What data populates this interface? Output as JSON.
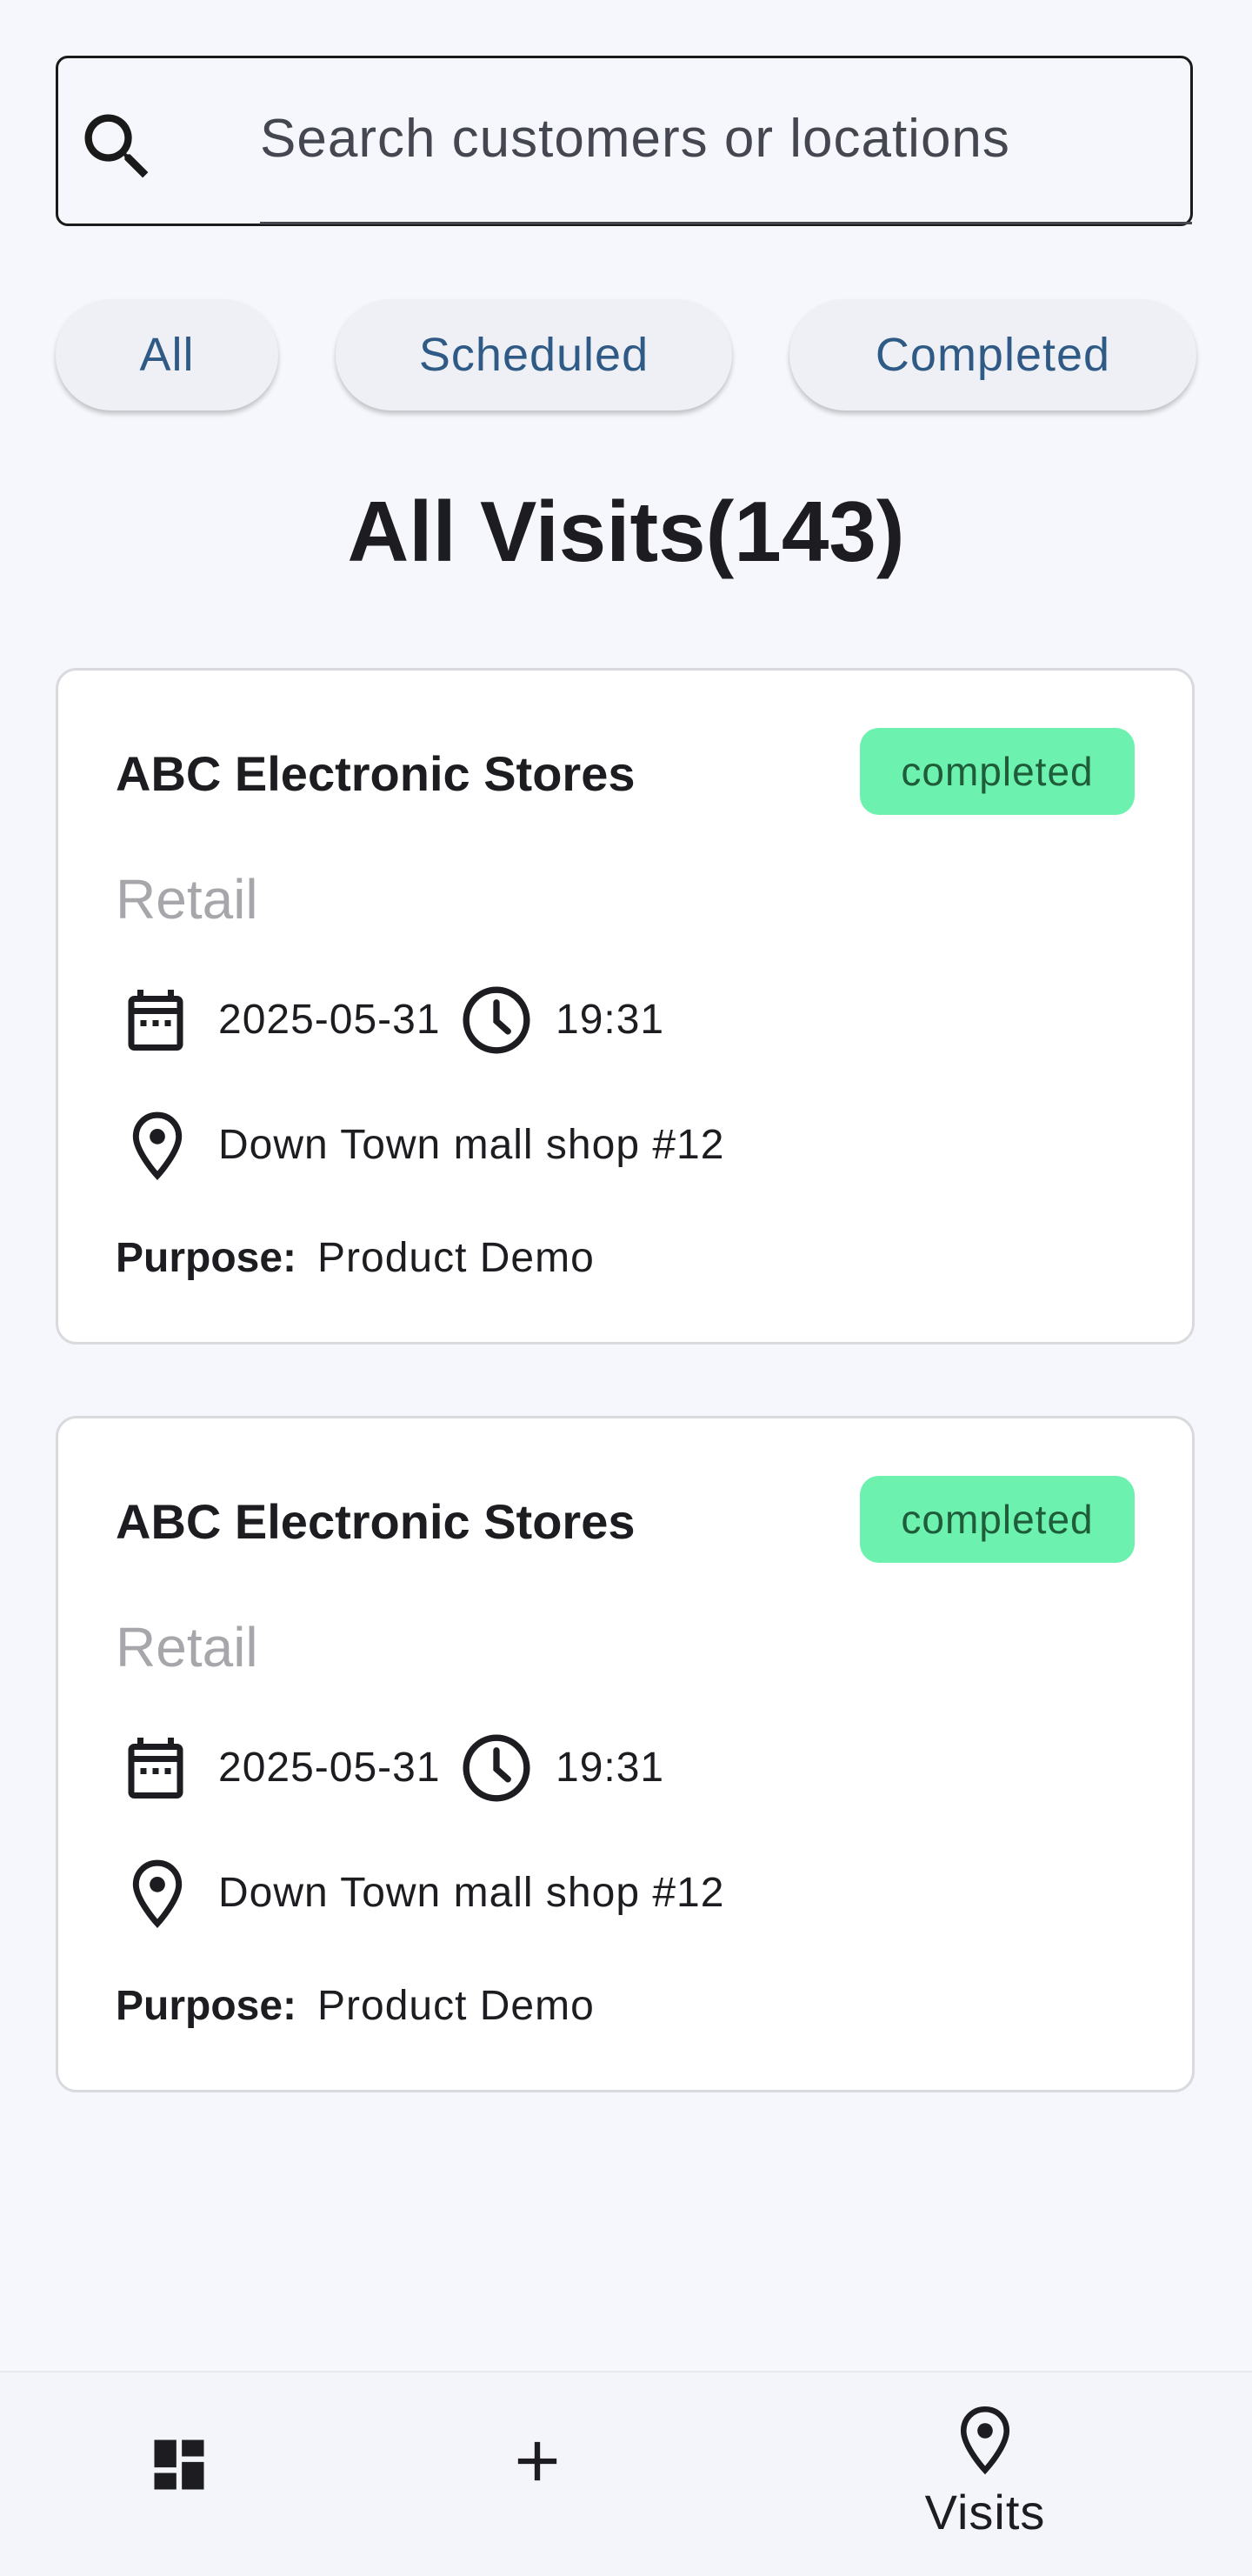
{
  "search": {
    "placeholder": "Search customers or locations",
    "icon": "search-icon"
  },
  "filters": [
    {
      "label": "All"
    },
    {
      "label": "Scheduled"
    },
    {
      "label": "Completed"
    }
  ],
  "page_title": "All Visits(143)",
  "visits": [
    {
      "customer": "ABC Electronic Stores",
      "status": "completed",
      "category": "Retail",
      "date": "2025-05-31",
      "time": "19:31",
      "location": "Down Town mall shop #12",
      "purpose_label": "Purpose:",
      "purpose": "Product Demo"
    },
    {
      "customer": "ABC Electronic Stores",
      "status": "completed",
      "category": "Retail",
      "date": "2025-05-31",
      "time": "19:31",
      "location": "Down Town mall shop #12",
      "purpose_label": "Purpose:",
      "purpose": "Product Demo"
    }
  ],
  "bottom_nav": {
    "items": [
      {
        "icon": "dashboard-icon"
      },
      {
        "icon": "add-icon"
      },
      {
        "icon": "location-pin-icon",
        "label": "Visits"
      }
    ]
  },
  "colors": {
    "background": "#f6f7fc",
    "chip_text": "#2f5a86",
    "status_completed": "#6cf1ae"
  }
}
